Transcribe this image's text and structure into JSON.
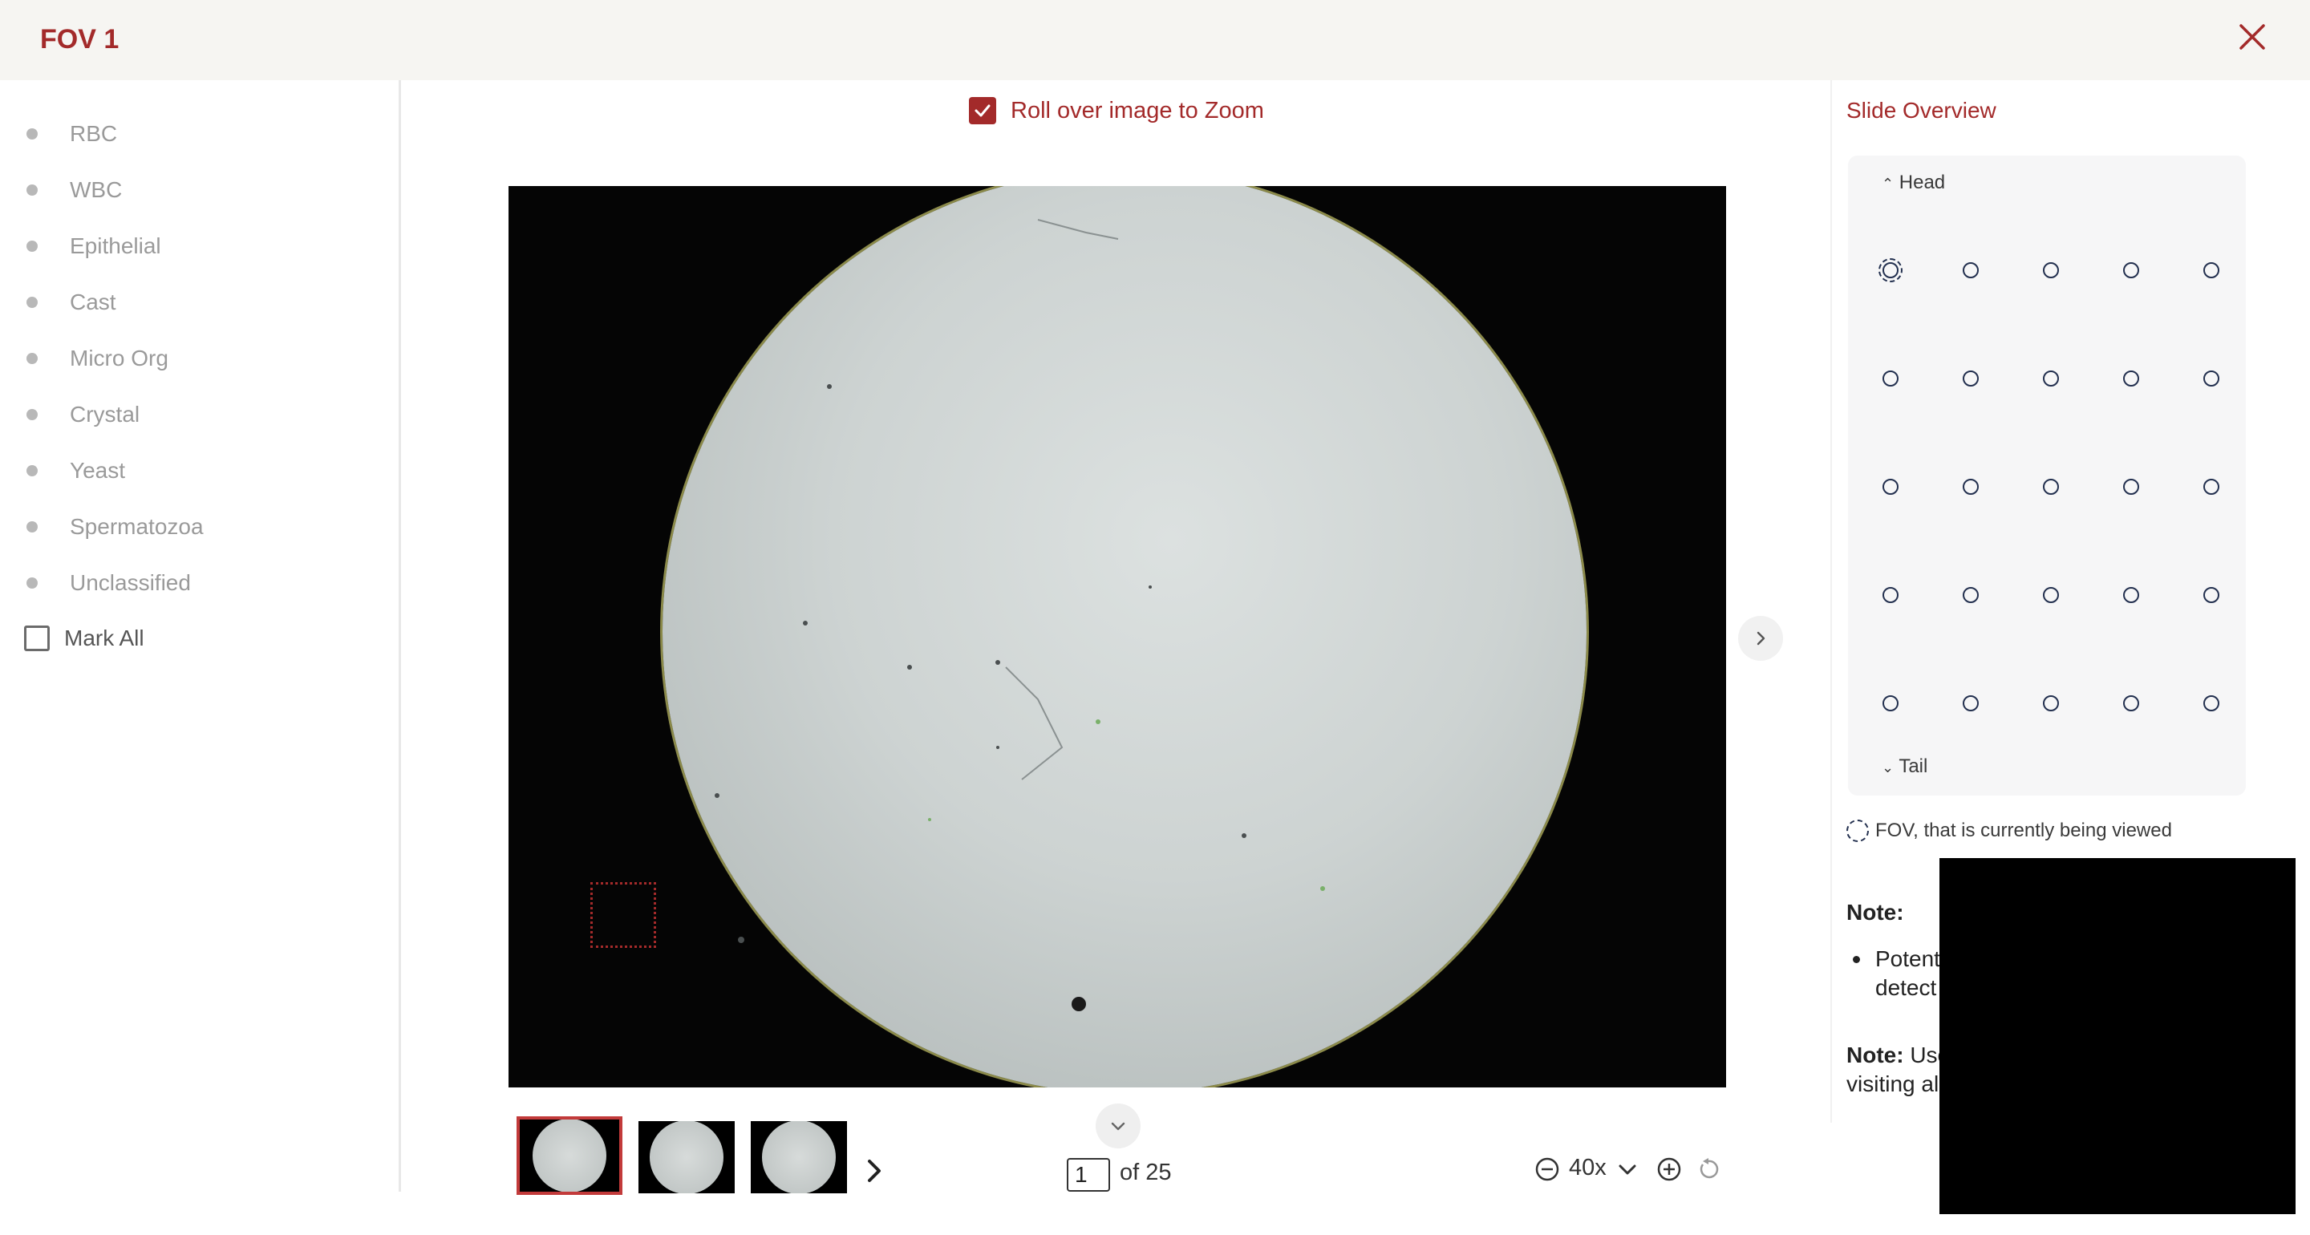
{
  "header": {
    "title": "FOV 1",
    "close_icon": "close-icon"
  },
  "sidebar": {
    "categories": [
      {
        "label": "RBC"
      },
      {
        "label": "WBC"
      },
      {
        "label": "Epithelial"
      },
      {
        "label": "Cast"
      },
      {
        "label": "Micro Org"
      },
      {
        "label": "Crystal"
      },
      {
        "label": "Yeast"
      },
      {
        "label": "Spermatozoa"
      },
      {
        "label": "Unclassified"
      }
    ],
    "mark_all": {
      "label": "Mark All",
      "checked": false
    }
  },
  "viewer": {
    "zoom_toggle": {
      "label": "Roll over image to Zoom",
      "checked": true
    },
    "next_icon": "chevron-right-icon"
  },
  "thumbnails": {
    "count_visible": 3,
    "active_index": 0
  },
  "pagination": {
    "current": "1",
    "of_label": "of 25"
  },
  "zoom": {
    "value": "40x",
    "options_icon": "chevron-down-icon"
  },
  "slide_overview": {
    "title": "Slide Overview",
    "head_label": "Head",
    "tail_label": "Tail",
    "rows": 5,
    "cols": 5,
    "current_fov": 1,
    "legend": "FOV, that is currently being viewed"
  },
  "notes": {
    "note_label": "Note:",
    "bullet_visible": "Potent",
    "bullet_visible_2": "detect",
    "note2_label": "Note:",
    "note2_text_1": "Use",
    "note2_text_2": "visiting al"
  },
  "colors": {
    "accent": "#a32a2a",
    "dot": "#23304f"
  }
}
